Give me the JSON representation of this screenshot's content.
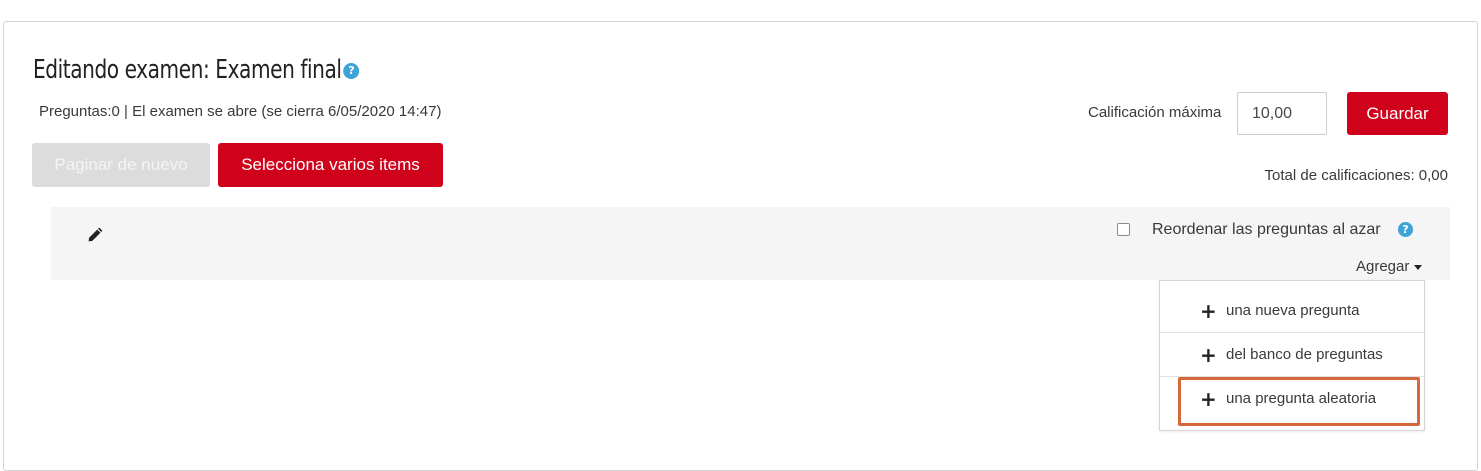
{
  "header": {
    "title": "Editando examen: Examen final",
    "help_icon": "question-circle-icon",
    "status": "Preguntas:0 | El examen se abre (se cierra 6/05/2020 14:47)"
  },
  "grading": {
    "max_grade_label": "Calificación máxima",
    "max_grade_value": "10,00",
    "save_label": "Guardar",
    "total_label": "Total de calificaciones: 0,00"
  },
  "actions": {
    "repaginate_label": "Paginar de nuevo",
    "select_multiple_label": "Selecciona varios items"
  },
  "section": {
    "edit_icon": "pencil-icon",
    "shuffle_label": "Reordenar las preguntas al azar",
    "shuffle_checked": false,
    "add_label": "Agregar",
    "add_menu": [
      {
        "icon": "plus-icon",
        "label": "una nueva pregunta"
      },
      {
        "icon": "plus-icon",
        "label": "del banco de preguntas"
      },
      {
        "icon": "plus-icon",
        "label": "una pregunta aleatoria"
      }
    ]
  },
  "colors": {
    "primary": "#d0021b",
    "disabled": "#dcdcdc",
    "info": "#3ea3d8",
    "highlight": "#d5683a"
  }
}
